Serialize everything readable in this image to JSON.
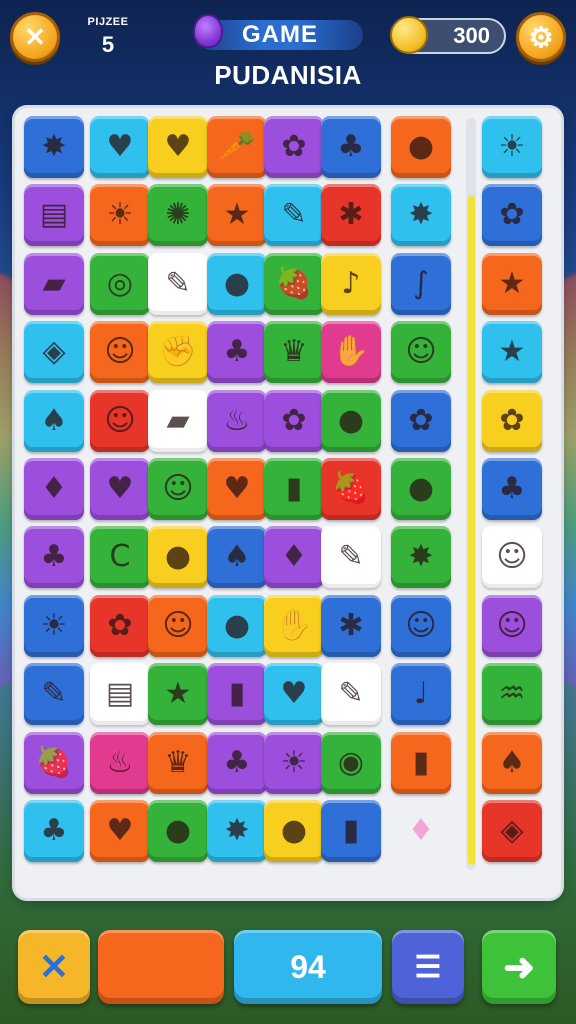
{
  "header": {
    "close_icon": "✕",
    "puzzle_label": "PIJZEE",
    "puzzle_number": "5",
    "title_word": "GAME",
    "subtitle": "PUDANISIA",
    "coins": "300",
    "gear_icon": "⚙"
  },
  "colors": {
    "blue": "#2f6fd8",
    "cyan": "#2fc0ee",
    "yellow": "#f8cf1e",
    "orange": "#f4671c",
    "purple": "#9b4fdc",
    "green": "#35b23a",
    "pink": "#e03b8f",
    "red": "#e8352a",
    "white": "#ffffff"
  },
  "board": {
    "rows": [
      [
        [
          "blue",
          "✸"
        ],
        [
          "cyan",
          "♥"
        ],
        [
          "yellow",
          "♥"
        ],
        [
          "orange",
          "🥕"
        ],
        [
          "purple",
          "✿"
        ],
        [
          "blue",
          "♣"
        ],
        [
          "orange",
          "●"
        ],
        [
          "cyan",
          "☀"
        ]
      ],
      [
        [
          "purple",
          "▤"
        ],
        [
          "orange",
          "☀"
        ],
        [
          "green",
          "✺"
        ],
        [
          "orange",
          "★"
        ],
        [
          "cyan",
          "✎"
        ],
        [
          "red",
          "✱"
        ],
        [
          "cyan",
          "✸"
        ],
        [
          "blue",
          "✿"
        ]
      ],
      [
        [
          "purple",
          "▰"
        ],
        [
          "green",
          "◎"
        ],
        [
          "white",
          "✎"
        ],
        [
          "cyan",
          "●"
        ],
        [
          "green",
          "🍓"
        ],
        [
          "yellow",
          "♪"
        ],
        [
          "blue",
          "∫"
        ],
        [
          "orange",
          "★"
        ]
      ],
      [
        [
          "cyan",
          "◈"
        ],
        [
          "orange",
          "☺"
        ],
        [
          "yellow",
          "✊"
        ],
        [
          "purple",
          "♣"
        ],
        [
          "green",
          "♛"
        ],
        [
          "pink",
          "✋"
        ],
        [
          "green",
          "☺"
        ],
        [
          "cyan",
          "★"
        ]
      ],
      [
        [
          "cyan",
          "♠"
        ],
        [
          "red",
          "☺"
        ],
        [
          "white",
          "▰"
        ],
        [
          "purple",
          "♨"
        ],
        [
          "purple",
          "✿"
        ],
        [
          "green",
          "●"
        ],
        [
          "blue",
          "✿"
        ],
        [
          "yellow",
          "✿"
        ]
      ],
      [
        [
          "purple",
          "♦"
        ],
        [
          "purple",
          "♥"
        ],
        [
          "green",
          "☺"
        ],
        [
          "orange",
          "♥"
        ],
        [
          "green",
          "▮"
        ],
        [
          "red",
          "🍓"
        ],
        [
          "green",
          "●"
        ],
        [
          "blue",
          "♣"
        ]
      ],
      [
        [
          "purple",
          "♣"
        ],
        [
          "green",
          "C"
        ],
        [
          "yellow",
          "●"
        ],
        [
          "blue",
          "♠"
        ],
        [
          "purple",
          "♦"
        ],
        [
          "white",
          "✎"
        ],
        [
          "green",
          "✸"
        ],
        [
          "white",
          "☺"
        ]
      ],
      [
        [
          "blue",
          "☀"
        ],
        [
          "red",
          "✿"
        ],
        [
          "orange",
          "☺"
        ],
        [
          "cyan",
          "●"
        ],
        [
          "yellow",
          "✋"
        ],
        [
          "blue",
          "✱"
        ],
        [
          "blue",
          "☺"
        ],
        [
          "purple",
          "☺"
        ]
      ],
      [
        [
          "blue",
          "✎"
        ],
        [
          "white",
          "▤"
        ],
        [
          "green",
          "★"
        ],
        [
          "purple",
          "▮"
        ],
        [
          "cyan",
          "♥"
        ],
        [
          "white",
          "✎"
        ],
        [
          "blue",
          "♩"
        ],
        [
          "green",
          "♒"
        ]
      ],
      [
        [
          "purple",
          "🍓"
        ],
        [
          "pink",
          "♨"
        ],
        [
          "orange",
          "♛"
        ],
        [
          "purple",
          "♣"
        ],
        [
          "purple",
          "☀"
        ],
        [
          "green",
          "◉"
        ],
        [
          "orange",
          "▮"
        ],
        [
          "orange",
          "♠"
        ]
      ],
      [
        [
          "cyan",
          "♣"
        ],
        [
          "orange",
          "♥"
        ],
        [
          "green",
          "●"
        ],
        [
          "cyan",
          "✸"
        ],
        [
          "yellow",
          "●"
        ],
        [
          "blue",
          "▮"
        ],
        [
          "none",
          "♦"
        ],
        [
          "red",
          "◈"
        ]
      ]
    ]
  },
  "bottom_bar": {
    "shuffle_icon": "✕",
    "score": "94",
    "list_icon": "☰",
    "next_icon": "➜"
  }
}
